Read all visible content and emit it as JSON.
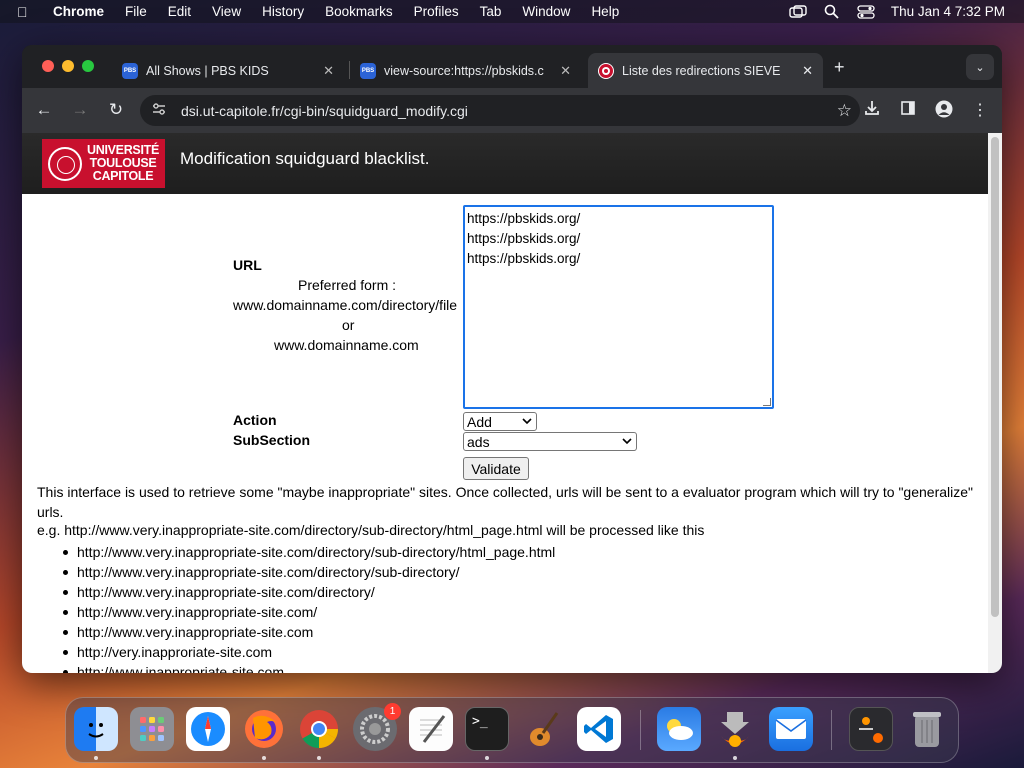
{
  "menubar": {
    "app": "Chrome",
    "items": [
      "File",
      "Edit",
      "View",
      "History",
      "Bookmarks",
      "Profiles",
      "Tab",
      "Window",
      "Help"
    ],
    "clock": "Thu Jan 4  7:32 PM"
  },
  "browser": {
    "tabs": [
      {
        "title": "All Shows | PBS KIDS",
        "favicon": "pbs-kids-icon"
      },
      {
        "title": "view-source:https://pbskids.c",
        "favicon": "pbs-kids-icon"
      },
      {
        "title": "Liste des redirections SIEVE",
        "favicon": "target-icon"
      }
    ],
    "address": "dsi.ut-capitole.fr/cgi-bin/squidguard_modify.cgi"
  },
  "page": {
    "header_title": "Modification squidguard blacklist.",
    "logo_lines": [
      "UNIVERSITÉ",
      "TOULOUSE",
      "CAPITOLE"
    ],
    "url_label": "URL",
    "preferred_form": "Preferred form :",
    "example_full": "www.domainname.com/directory/file",
    "or": "or",
    "example_short": "www.domainname.com",
    "textarea_lines": [
      "https://pbskids.org/",
      "https://pbskids.org/",
      "https://pbskids.org/"
    ],
    "action_label": "Action",
    "action_value": "Add",
    "subsection_label": "SubSection",
    "subsection_value": "ads",
    "validate": "Validate",
    "description": "This interface is used to retrieve some \"maybe inappropriate\" sites. Once collected, urls will be sent to a evaluator program which will try to \"generalize\" urls.",
    "example_intro": "e.g. http://www.very.inappropriate-site.com/directory/sub-directory/html_page.html will be processed like this",
    "example_list": [
      "http://www.very.inappropriate-site.com/directory/sub-directory/html_page.html",
      "http://www.very.inappropriate-site.com/directory/sub-directory/",
      "http://www.very.inappropriate-site.com/directory/",
      "http://www.very.inappropriate-site.com/",
      "http://www.very.inappropriate-site.com",
      "http://very.inapproriate-site.com",
      "http://www.inappropriate-site.com"
    ]
  },
  "dock": {
    "apps": [
      "Finder",
      "Launchpad",
      "Safari",
      "Firefox",
      "Chrome",
      "System Settings",
      "TextEdit",
      "Terminal",
      "GarageBand",
      "VS Code",
      "Weather",
      "Installer",
      "Mail",
      "Downloads",
      "Trash"
    ],
    "settings_badge": "1"
  }
}
